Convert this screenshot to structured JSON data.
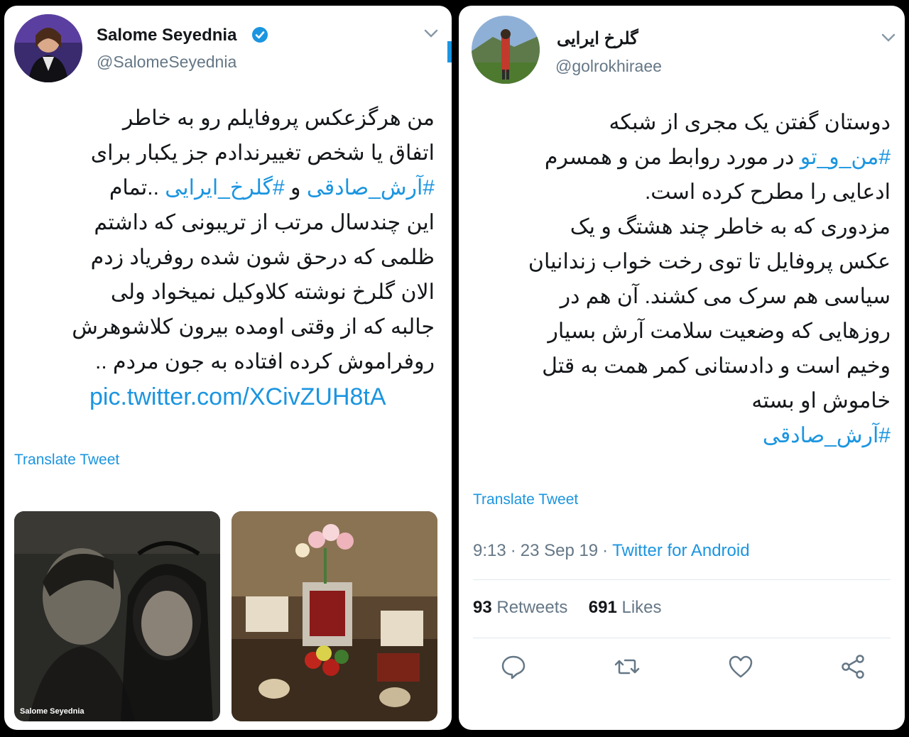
{
  "left_tweet": {
    "author_name": "Salome Seyednia",
    "handle": "@SalomeSeyednia",
    "text_lines": [
      "من هرگزعکس پروفایلم رو به خاطر",
      "اتفاق یا شخص تغییرندادم جز یکبار برای",
      "",
      "این چندسال مرتب از تریبونی که داشتم",
      "ظلمی که درحق شون شده روفریاد زدم",
      "الان گلرخ نوشته کلاوکیل نمیخواد ولی",
      "جالبه که از وقتی اومده بیرون کلاشوهرش",
      "روفراموش کرده افتاده به جون مردم .."
    ],
    "line3": {
      "hashtag1": "#آرش_صادقی",
      "connector": " و ",
      "hashtag2": "#گلرخ_ایرایی",
      "tail": " ..تمام"
    },
    "link": "pic.twitter.com/XCivZUH8tA",
    "translate_label": "Translate Tweet",
    "photo_caption": "Salome Seyednia",
    "icons": [
      "verified-badge-icon",
      "chevron-down-icon"
    ]
  },
  "right_tweet": {
    "author_name": "گلرخ ایرایی",
    "handle": "@golrokhiraee",
    "line1": "دوستان گفتن یک مجری از شبکه",
    "line2": {
      "hashtag": "#من_و_تو",
      "rest": " در مورد روابط من و همسرم"
    },
    "text_lines": [
      "ادعایی را مطرح کرده است.",
      "مزدوری که به خاطر چند هشتگ و یک",
      "عکس پروفایل تا توی رخت خواب زندانیان",
      "سیاسی هم سرک می کشند. آن هم در",
      "روزهایی که وضعیت سلامت آرش بسیار",
      "وخیم است و دادستانی کمر همت به قتل",
      "خاموش او بسته"
    ],
    "hashtag_last": "#آرش_صادقی",
    "translate_label": "Translate Tweet",
    "time": "9:13",
    "date": "23 Sep 19",
    "dot": "·",
    "source": "Twitter for Android",
    "retweets_count": "93",
    "retweets_label": "Retweets",
    "likes_count": "691",
    "likes_label": "Likes",
    "icons": [
      "reply-icon",
      "retweet-icon",
      "like-icon",
      "share-icon",
      "chevron-down-icon"
    ]
  },
  "colors": {
    "link_blue": "#1b95e0",
    "text_dark": "#14171a",
    "text_gray": "#657786",
    "divider": "#e1e8ed"
  }
}
